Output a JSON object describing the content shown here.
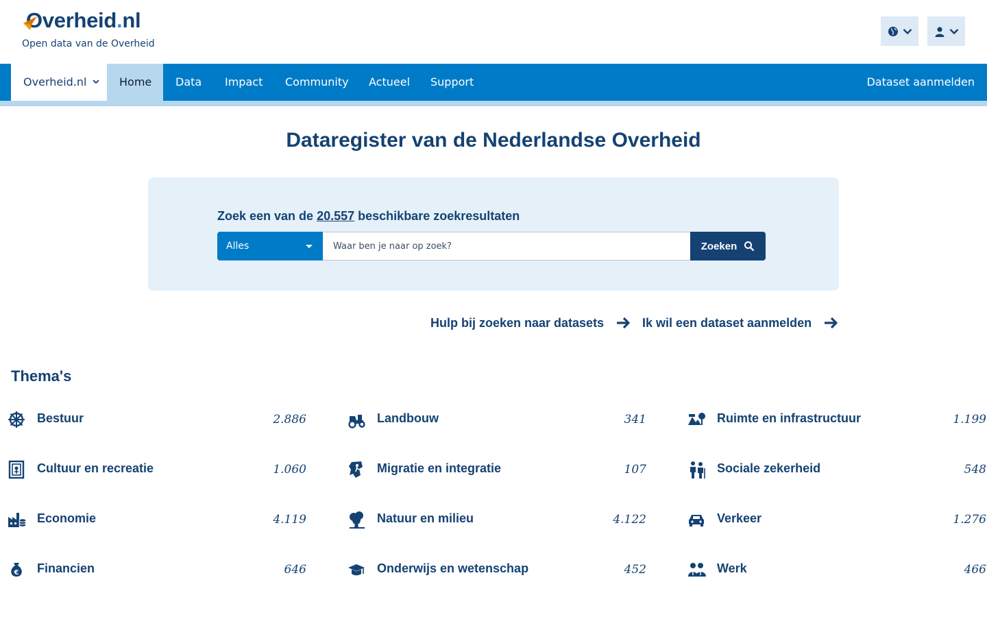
{
  "header": {
    "logo_text": "Overheid",
    "logo_dot": ".",
    "logo_tld": "nl",
    "tagline": "Open data van de Overheid",
    "language_icon": "globe-icon",
    "user_icon": "user-icon"
  },
  "nav": {
    "site_selector": "Overheid.nl",
    "items": [
      "Home",
      "Data",
      "Impact",
      "Community",
      "Actueel",
      "Support"
    ],
    "right_link": "Dataset aanmelden"
  },
  "main": {
    "title": "Dataregister van de Nederlandse Overheid",
    "search": {
      "label_prefix": "Zoek een van de",
      "count": "20.557",
      "label_suffix": "beschikbare zoekresultaten",
      "filter_value": "Alles",
      "placeholder": "Waar ben je naar op zoek?",
      "button": "Zoeken"
    },
    "help_links": [
      "Hulp bij zoeken naar datasets",
      "Ik wil een dataset aanmelden"
    ],
    "themes_title": "Thema's",
    "themes": [
      {
        "name": "Bestuur",
        "count": "2.886",
        "icon": "ship-wheel-icon"
      },
      {
        "name": "Landbouw",
        "count": "341",
        "icon": "tractor-icon"
      },
      {
        "name": "Ruimte en infrastructuur",
        "count": "1.199",
        "icon": "landscape-icon"
      },
      {
        "name": "Cultuur en recreatie",
        "count": "1.060",
        "icon": "painting-icon"
      },
      {
        "name": "Migratie en integratie",
        "count": "107",
        "icon": "map-person-icon"
      },
      {
        "name": "Sociale zekerheid",
        "count": "548",
        "icon": "people-icon"
      },
      {
        "name": "Economie",
        "count": "4.119",
        "icon": "factory-icon"
      },
      {
        "name": "Natuur en milieu",
        "count": "4.122",
        "icon": "tree-icon"
      },
      {
        "name": "Verkeer",
        "count": "1.276",
        "icon": "car-icon"
      },
      {
        "name": "Financien",
        "count": "646",
        "icon": "money-bag-icon"
      },
      {
        "name": "Onderwijs en wetenschap",
        "count": "452",
        "icon": "graduation-cap-icon"
      },
      {
        "name": "Werk",
        "count": "466",
        "icon": "workers-icon"
      }
    ]
  },
  "colors": {
    "primary_dark": "#154273",
    "nav_blue": "#007bc7",
    "nav_light": "#b7d7ef",
    "panel_bg": "#e5f0f9"
  }
}
